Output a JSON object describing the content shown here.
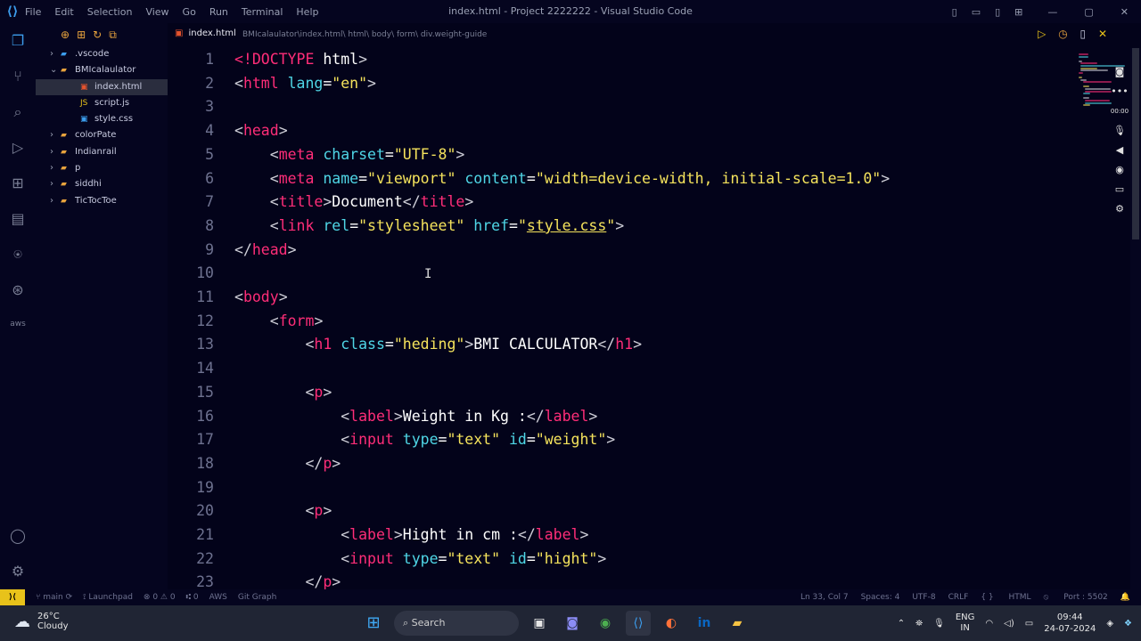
{
  "titlebar": {
    "menu": [
      "File",
      "Edit",
      "Selection",
      "View",
      "Go",
      "Run",
      "Terminal",
      "Help"
    ],
    "window_title": "index.html - Project 2222222 - Visual Studio Code"
  },
  "explorer": {
    "items": [
      {
        "label": ".vscode",
        "type": "folder",
        "open": false,
        "depth": 0
      },
      {
        "label": "BMIcalaulator",
        "type": "folder",
        "open": true,
        "depth": 0
      },
      {
        "label": "index.html",
        "type": "html",
        "depth": 1,
        "selected": true
      },
      {
        "label": "script.js",
        "type": "js",
        "depth": 1
      },
      {
        "label": "style.css",
        "type": "css",
        "depth": 1
      },
      {
        "label": "colorPate",
        "type": "folder",
        "open": false,
        "depth": 0
      },
      {
        "label": "Indianrail",
        "type": "folder",
        "open": false,
        "depth": 0
      },
      {
        "label": "p",
        "type": "folder",
        "open": false,
        "depth": 0
      },
      {
        "label": "siddhi",
        "type": "folder",
        "open": false,
        "depth": 0
      },
      {
        "label": "TicTocToe",
        "type": "folder",
        "open": false,
        "depth": 0
      }
    ]
  },
  "editor": {
    "tab_label": "index.html",
    "breadcrumb": "BMIcalaulator\\index.html\\ html\\ body\\ form\\ div.weight-guide",
    "lines": [
      [
        [
          "t",
          "<!"
        ],
        [
          "t",
          "DOCTYPE"
        ],
        [
          "x",
          " html"
        ],
        [
          "b",
          ">"
        ]
      ],
      [
        [
          "b",
          "<"
        ],
        [
          "t",
          "html"
        ],
        [
          "a",
          " lang"
        ],
        [
          "x",
          "="
        ],
        [
          "s",
          "\"en\""
        ],
        [
          "b",
          ">"
        ]
      ],
      [],
      [
        [
          "b",
          "<"
        ],
        [
          "t",
          "head"
        ],
        [
          "b",
          ">"
        ]
      ],
      [
        [
          "x",
          "    "
        ],
        [
          "b",
          "<"
        ],
        [
          "t",
          "meta"
        ],
        [
          "a",
          " charset"
        ],
        [
          "x",
          "="
        ],
        [
          "s",
          "\"UTF-8\""
        ],
        [
          "b",
          ">"
        ]
      ],
      [
        [
          "x",
          "    "
        ],
        [
          "b",
          "<"
        ],
        [
          "t",
          "meta"
        ],
        [
          "a",
          " name"
        ],
        [
          "x",
          "="
        ],
        [
          "s",
          "\"viewport\""
        ],
        [
          "a",
          " content"
        ],
        [
          "x",
          "="
        ],
        [
          "s",
          "\"width=device-width, initial-scale=1.0\""
        ],
        [
          "b",
          ">"
        ]
      ],
      [
        [
          "x",
          "    "
        ],
        [
          "b",
          "<"
        ],
        [
          "t",
          "title"
        ],
        [
          "b",
          ">"
        ],
        [
          "x",
          "Document"
        ],
        [
          "b",
          "</"
        ],
        [
          "t",
          "title"
        ],
        [
          "b",
          ">"
        ]
      ],
      [
        [
          "x",
          "    "
        ],
        [
          "b",
          "<"
        ],
        [
          "t",
          "link"
        ],
        [
          "a",
          " rel"
        ],
        [
          "x",
          "="
        ],
        [
          "s",
          "\"stylesheet\""
        ],
        [
          "a",
          " href"
        ],
        [
          "x",
          "="
        ],
        [
          "s",
          "\""
        ],
        [
          "su",
          "style.css"
        ],
        [
          "s",
          "\""
        ],
        [
          "b",
          ">"
        ]
      ],
      [
        [
          "b",
          "</"
        ],
        [
          "t",
          "head"
        ],
        [
          "b",
          ">"
        ]
      ],
      [],
      [
        [
          "b",
          "<"
        ],
        [
          "t",
          "body"
        ],
        [
          "b",
          ">"
        ]
      ],
      [
        [
          "x",
          "    "
        ],
        [
          "b",
          "<"
        ],
        [
          "t",
          "form"
        ],
        [
          "b",
          ">"
        ]
      ],
      [
        [
          "x",
          "        "
        ],
        [
          "b",
          "<"
        ],
        [
          "t",
          "h1"
        ],
        [
          "a",
          " class"
        ],
        [
          "x",
          "="
        ],
        [
          "s",
          "\"heding\""
        ],
        [
          "b",
          ">"
        ],
        [
          "x",
          "BMI CALCULATOR"
        ],
        [
          "b",
          "</"
        ],
        [
          "t",
          "h1"
        ],
        [
          "b",
          ">"
        ]
      ],
      [],
      [
        [
          "x",
          "        "
        ],
        [
          "b",
          "<"
        ],
        [
          "t",
          "p"
        ],
        [
          "b",
          ">"
        ]
      ],
      [
        [
          "x",
          "            "
        ],
        [
          "b",
          "<"
        ],
        [
          "t",
          "label"
        ],
        [
          "b",
          ">"
        ],
        [
          "x",
          "Weight in Kg :"
        ],
        [
          "b",
          "</"
        ],
        [
          "t",
          "label"
        ],
        [
          "b",
          ">"
        ]
      ],
      [
        [
          "x",
          "            "
        ],
        [
          "b",
          "<"
        ],
        [
          "t",
          "input"
        ],
        [
          "a",
          " type"
        ],
        [
          "x",
          "="
        ],
        [
          "s",
          "\"text\""
        ],
        [
          "a",
          " id"
        ],
        [
          "x",
          "="
        ],
        [
          "s",
          "\"weight\""
        ],
        [
          "b",
          ">"
        ]
      ],
      [
        [
          "x",
          "        "
        ],
        [
          "b",
          "</"
        ],
        [
          "t",
          "p"
        ],
        [
          "b",
          ">"
        ]
      ],
      [],
      [
        [
          "x",
          "        "
        ],
        [
          "b",
          "<"
        ],
        [
          "t",
          "p"
        ],
        [
          "b",
          ">"
        ]
      ],
      [
        [
          "x",
          "            "
        ],
        [
          "b",
          "<"
        ],
        [
          "t",
          "label"
        ],
        [
          "b",
          ">"
        ],
        [
          "x",
          "Hight in cm :"
        ],
        [
          "b",
          "</"
        ],
        [
          "t",
          "label"
        ],
        [
          "b",
          ">"
        ]
      ],
      [
        [
          "x",
          "            "
        ],
        [
          "b",
          "<"
        ],
        [
          "t",
          "input"
        ],
        [
          "a",
          " type"
        ],
        [
          "x",
          "="
        ],
        [
          "s",
          "\"text\""
        ],
        [
          "a",
          " id"
        ],
        [
          "x",
          "="
        ],
        [
          "s",
          "\"hight\""
        ],
        [
          "b",
          ">"
        ]
      ],
      [
        [
          "x",
          "        "
        ],
        [
          "b",
          "</"
        ],
        [
          "t",
          "p"
        ],
        [
          "b",
          ">"
        ]
      ]
    ]
  },
  "statusbar": {
    "branch": "main",
    "launchpad": "Launchpad",
    "problems": "0 ⚠ 0",
    "ports": "0",
    "aws": "AWS",
    "git_graph": "Git Graph",
    "position": "Ln 33, Col 7",
    "spaces": "Spaces: 4",
    "encoding": "UTF-8",
    "eol": "CRLF",
    "language": "HTML",
    "port": "Port : 5502"
  },
  "overlay": {
    "timer": "00:00"
  },
  "taskbar": {
    "temperature": "26°C",
    "condition": "Cloudy",
    "search_placeholder": "Search",
    "lang_line1": "ENG",
    "lang_line2": "IN",
    "time": "09:44",
    "date": "24-07-2024"
  }
}
